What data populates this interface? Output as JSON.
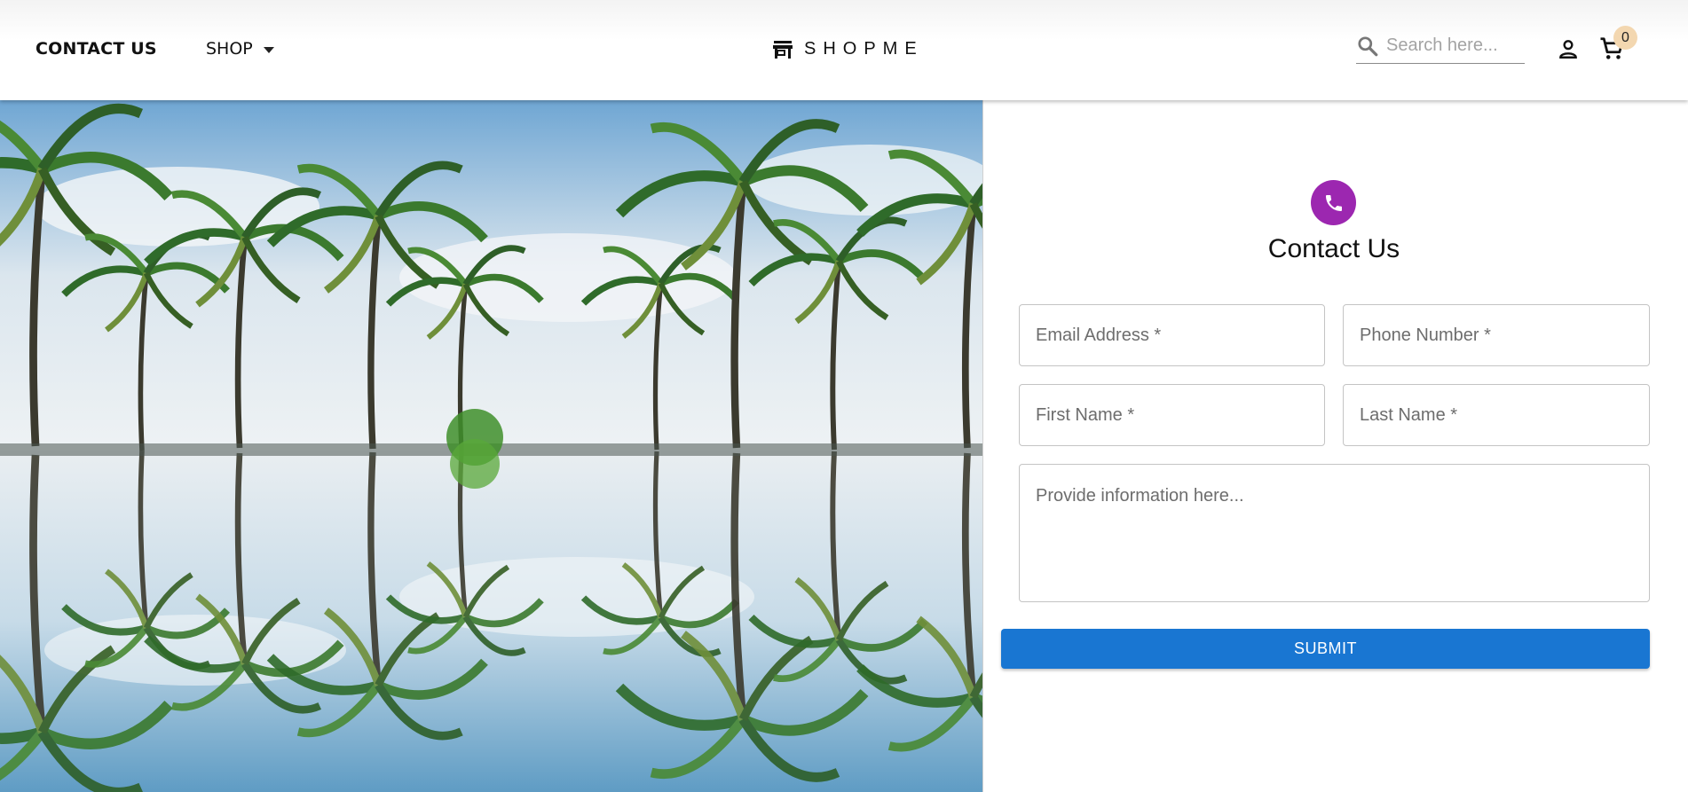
{
  "header": {
    "nav_contact": "CONTACT US",
    "nav_shop": "SHOP",
    "brand": "SHOPME",
    "search_placeholder": "Search here...",
    "cart_count": "0"
  },
  "contact_form": {
    "title": "Contact Us",
    "email_placeholder": "Email Address *",
    "phone_placeholder": "Phone Number *",
    "first_name_placeholder": "First Name *",
    "last_name_placeholder": "Last Name *",
    "info_placeholder": "Provide information here...",
    "submit_label": "SUBMIT"
  },
  "icons": {
    "brand": "store-icon",
    "search": "search-icon",
    "user": "person-icon",
    "cart": "shopping-cart-icon",
    "avatar": "phone-icon",
    "dropdown": "caret-down-icon"
  },
  "colors": {
    "accent": "#1976d2",
    "avatar": "#9c27b0",
    "cart_badge": "#f3d7b0"
  }
}
